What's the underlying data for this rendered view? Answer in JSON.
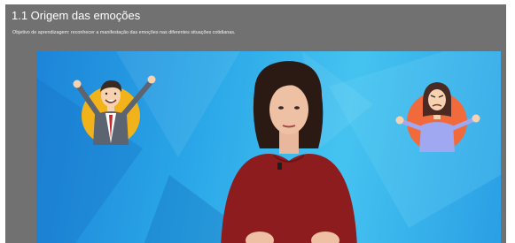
{
  "lesson": {
    "title": "1.1 Origem das emoções",
    "objective": "Objetivo de aprendizagem: reconhecer a manifestação das emoções nas diferentes situações cotidianas."
  },
  "video": {
    "scene": "presenter-with-emotion-illustrations"
  },
  "colors": {
    "panel_background": "#717171",
    "video_blue": "#2aa7e8",
    "left_circle": "#f2b21a",
    "right_circle": "#f06a3b",
    "presenter_dress": "#8c1c1e"
  }
}
